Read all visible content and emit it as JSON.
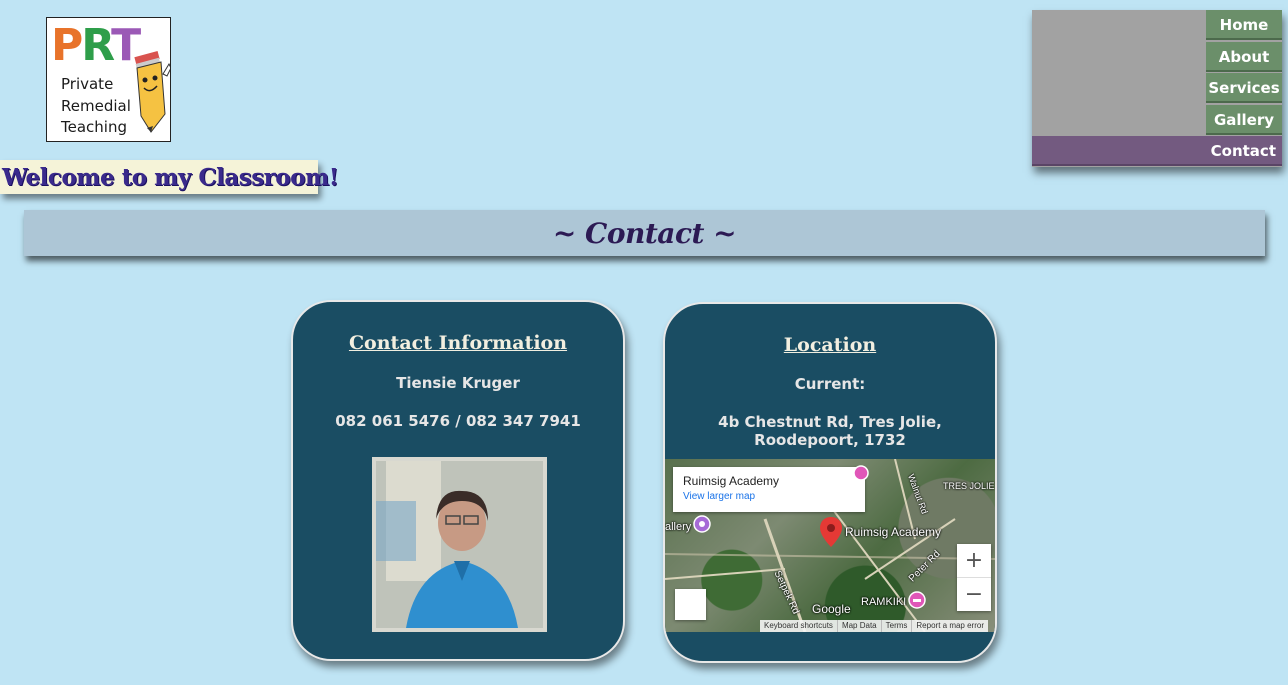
{
  "logo": {
    "letters": [
      "P",
      "R",
      "T"
    ],
    "lines": [
      "Private",
      "Remedial",
      "Teaching"
    ]
  },
  "welcome": "Welcome to my Classroom!",
  "nav": {
    "items": [
      "Home",
      "About",
      "Services",
      "Gallery",
      "Contact"
    ],
    "active": "Contact",
    "active_color": "#735a80",
    "item_color": "#6b8f6a"
  },
  "page_title": "~ Contact ~",
  "contact": {
    "heading": "Contact Information",
    "name": "Tiensie Kruger",
    "phones": "082 061 5476 / 082 347 7941"
  },
  "location": {
    "heading": "Location",
    "current_label": "Current:",
    "address": "4b Chestnut Rd, Tres Jolie, Roodepoort, 1732"
  },
  "map": {
    "place": "Ruimsig Academy",
    "larger_link": "View larger map",
    "pin_label": "Ruimsig Academy",
    "labels": [
      "allery",
      "TRES JOLIE",
      "Walnut Rd",
      "Peter Rd",
      "Setpek Rd",
      "RAMKIKI"
    ],
    "brand": "Google",
    "zoom_in": "+",
    "zoom_out": "−",
    "footer": [
      "Keyboard shortcuts",
      "Map Data",
      "Terms",
      "Report a map error"
    ]
  }
}
